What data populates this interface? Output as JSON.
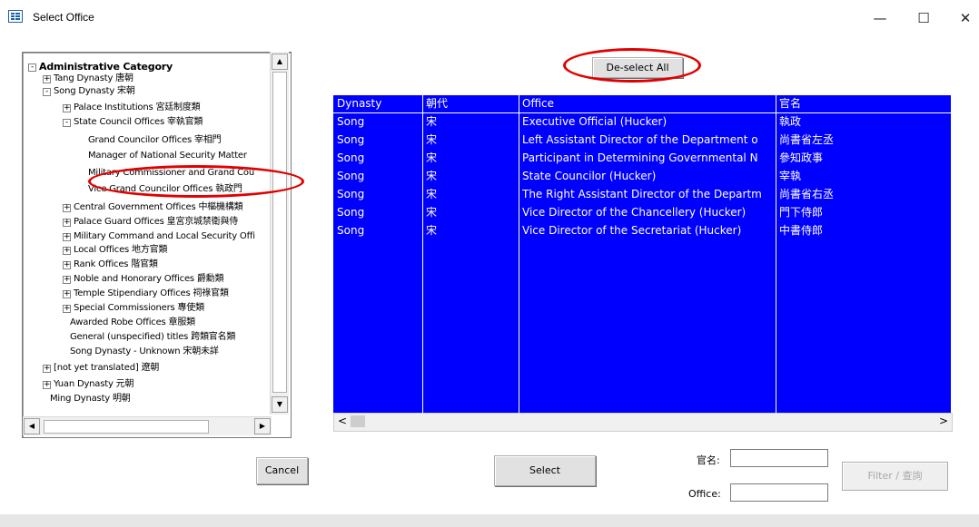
{
  "window": {
    "title": "Select Office",
    "minimize_icon": "minimize-icon",
    "maximize_icon": "maximize-icon",
    "close_icon": "close-icon"
  },
  "tree": {
    "nodes": [
      {
        "label": "Administrative Category",
        "bold": true,
        "toggle": "-"
      },
      {
        "label": "Tang Dynasty 唐朝",
        "toggle": "+"
      },
      {
        "label": "Song Dynasty 宋朝",
        "toggle": "-"
      },
      {
        "label": "Palace Institutions 宮廷制度類",
        "toggle": "+"
      },
      {
        "label": "State Council Offices 宰執官類",
        "toggle": "-"
      },
      {
        "label": "Grand Councilor Offices 宰相門",
        "toggle": ""
      },
      {
        "label": "Manager of National Security Matter",
        "toggle": ""
      },
      {
        "label": "Military Commissioner and Grand Cou",
        "toggle": ""
      },
      {
        "label": "Vice Grand Councilor Offices 執政門",
        "toggle": ""
      },
      {
        "label": "Central Government Offices 中樞機構類",
        "toggle": "+"
      },
      {
        "label": "Palace Guard Offices 皇宮京城禁衛與侍",
        "toggle": "+"
      },
      {
        "label": "Military Command and Local Security Offi",
        "toggle": "+"
      },
      {
        "label": "Local Offices 地方官類",
        "toggle": "+"
      },
      {
        "label": "Rank Offices 階官類",
        "toggle": "+"
      },
      {
        "label": "Noble and Honorary Offices 爵勳類",
        "toggle": "+"
      },
      {
        "label": "Temple Stipendiary Offices 祠祿官類",
        "toggle": "+"
      },
      {
        "label": "Special Commissioners 專使類",
        "toggle": "+"
      },
      {
        "label": "Awarded Robe Offices 章服類",
        "toggle": ""
      },
      {
        "label": "General (unspecified) titles 跨類官名類",
        "toggle": ""
      },
      {
        "label": "Song Dynasty - Unknown 宋朝未詳",
        "toggle": ""
      },
      {
        "label": "[not yet translated] 遼朝",
        "toggle": "+"
      },
      {
        "label": "Yuan Dynasty 元朝",
        "toggle": "+"
      },
      {
        "label": "Ming Dynasty 明朝",
        "toggle": ""
      }
    ]
  },
  "grid": {
    "headers": [
      "Dynasty",
      "朝代",
      "Office",
      "官名"
    ],
    "rows": [
      [
        "Song",
        "宋",
        "Executive Official (Hucker)",
        "執政"
      ],
      [
        "Song",
        "宋",
        "Left Assistant Director of the Department o",
        "尚書省左丞"
      ],
      [
        "Song",
        "宋",
        "Participant in Determining Governmental N",
        "參知政事"
      ],
      [
        "Song",
        "宋",
        "State Councilor (Hucker)",
        "宰執"
      ],
      [
        "Song",
        "宋",
        "The Right Assistant Director of the Departm",
        "尚書省右丞"
      ],
      [
        "Song",
        "宋",
        "Vice Director of the Chancellery (Hucker)",
        "門下侍郎"
      ],
      [
        "Song",
        "宋",
        "Vice Director of the Secretariat (Hucker)",
        "中書侍郎"
      ]
    ],
    "bg_color": "#0000ff"
  },
  "buttons": {
    "deselect_all": "De-select All",
    "cancel": "Cancel",
    "select": "Select",
    "filter": "Filter / 查詢"
  },
  "filters": {
    "chinese_label": "官名:",
    "office_label": "Office:",
    "chinese_value": "",
    "office_value": ""
  },
  "annotation_color": "#e10000"
}
